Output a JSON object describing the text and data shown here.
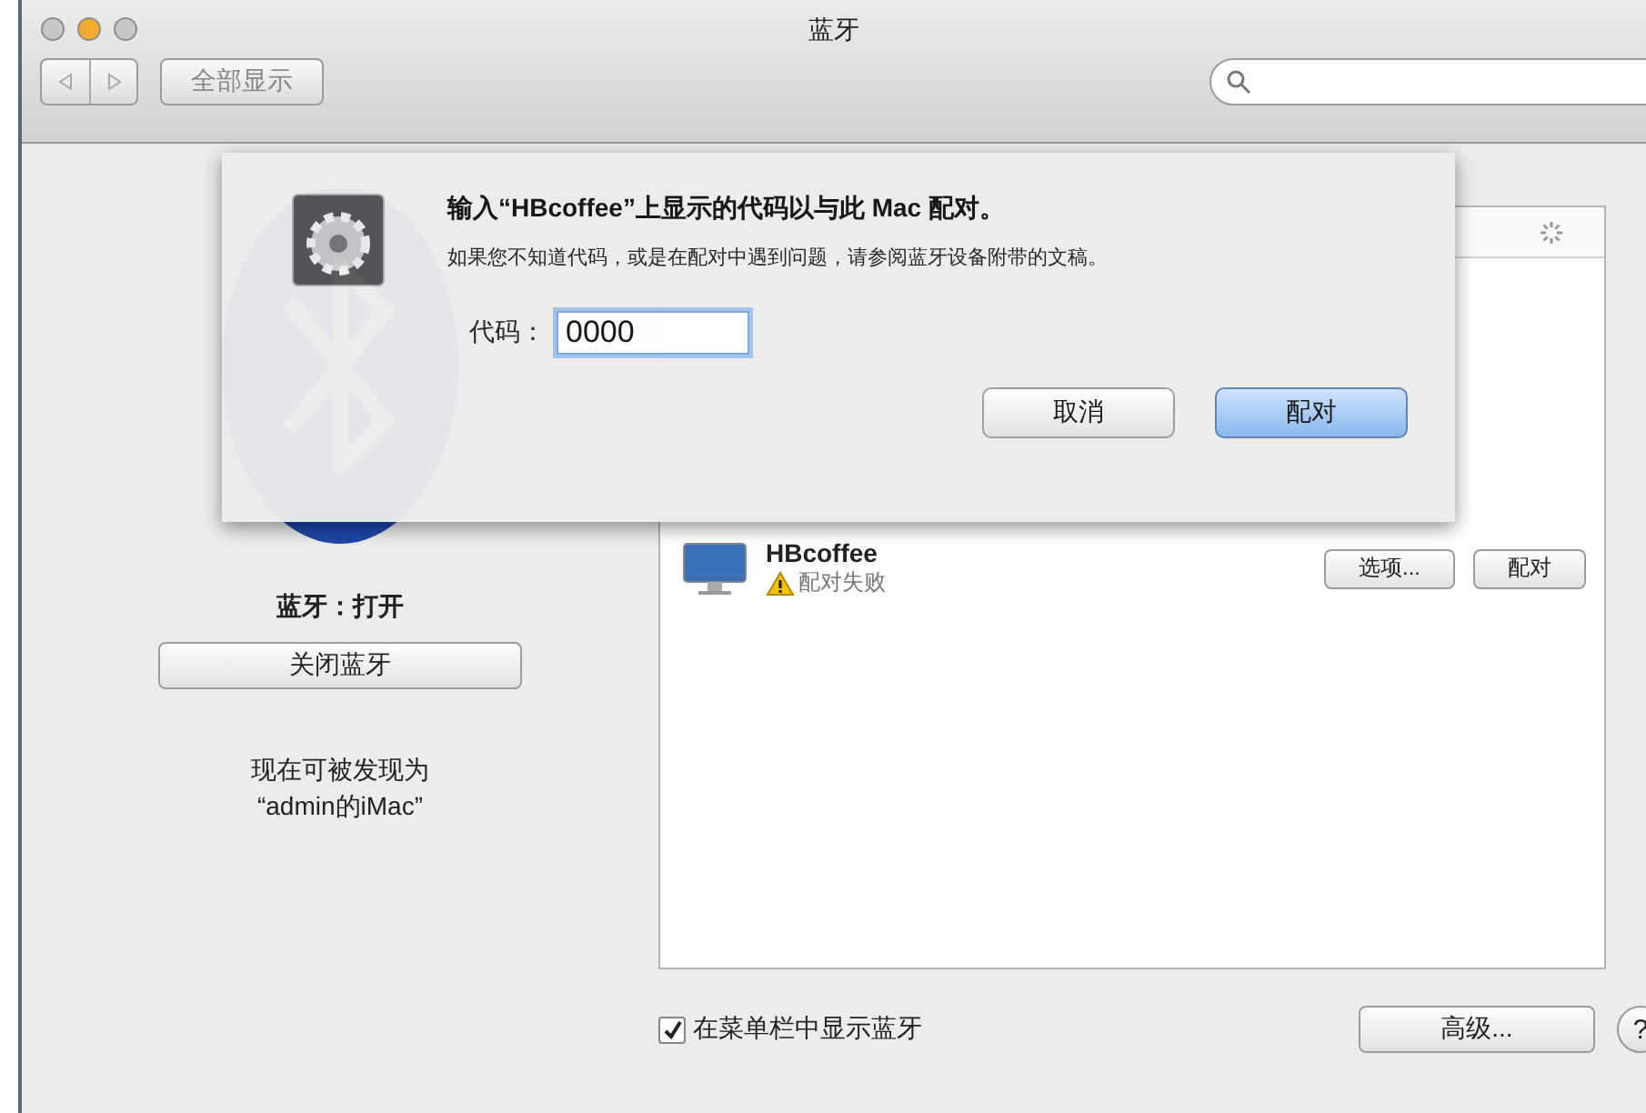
{
  "window": {
    "title": "蓝牙"
  },
  "toolbar": {
    "show_all": "全部显示"
  },
  "bluetooth": {
    "status": "蓝牙：打开",
    "toggle_button": "关闭蓝牙",
    "discoverable": [
      "现在可被发现为",
      "“admin的iMac”"
    ]
  },
  "devices": [
    {
      "name": "HBcoffee",
      "status": "配对失败",
      "warning": true,
      "buttons": [
        "选项...",
        "配对"
      ]
    }
  ],
  "show_in_menu_bar": {
    "label": "在菜单栏中显示蓝牙",
    "checked": true
  },
  "advanced_button": "高级...",
  "help_button": "?",
  "dialog": {
    "title": "输入“HBcoffee”上显示的代码以与此 Mac 配对。",
    "message": "如果您不知道代码，或是在配对中遇到问题，请参阅蓝牙设备附带的文稿。",
    "code_label": "代码：",
    "code_value": "0000",
    "buttons": [
      {
        "label": "取消",
        "default": false
      },
      {
        "label": "配对",
        "default": true
      }
    ]
  }
}
